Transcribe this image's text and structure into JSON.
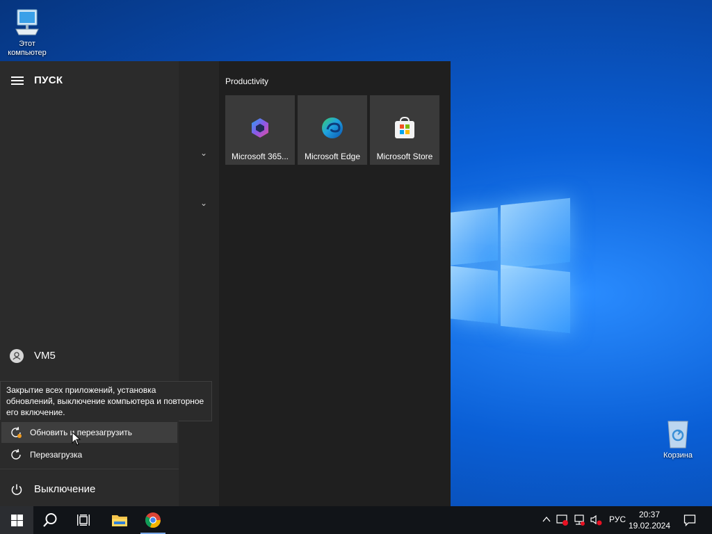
{
  "desktop": {
    "icons": [
      {
        "label": "Этот компьютер"
      },
      {
        "label": "Корзина"
      }
    ]
  },
  "start_menu": {
    "title": "ПУСК",
    "user": "VM5",
    "tooltip": "Закрытие всех приложений, установка обновлений, выключение компьютера и повторное его включение.",
    "power_options": [
      {
        "label": "Обновить и перезагрузить",
        "icon": "update-restart-icon",
        "active": true
      },
      {
        "label": "Перезагрузка",
        "icon": "restart-icon",
        "active": false
      }
    ],
    "power_label": "Выключение",
    "group_title": "Productivity",
    "tiles": [
      {
        "label": "Microsoft 365...",
        "icon": "microsoft-365-icon"
      },
      {
        "label": "Microsoft Edge",
        "icon": "edge-icon"
      },
      {
        "label": "Microsoft Store",
        "icon": "store-icon"
      }
    ]
  },
  "taskbar": {
    "apps": [
      {
        "name": "start",
        "icon": "windows-logo-icon"
      },
      {
        "name": "search",
        "icon": "search-icon"
      },
      {
        "name": "task-view",
        "icon": "task-view-icon"
      },
      {
        "name": "file-explorer",
        "icon": "folder-icon"
      },
      {
        "name": "chrome",
        "icon": "chrome-icon"
      }
    ],
    "language": "РУС",
    "time": "20:37",
    "date": "19.02.2024"
  },
  "colors": {
    "accent": "#0a5fd6",
    "start_bg": "#1f1f1f",
    "rail_bg": "#2b2b2b",
    "tile_bg": "#3a3a3a",
    "taskbar_bg": "#111418",
    "update_dot": "#f29b1e"
  }
}
